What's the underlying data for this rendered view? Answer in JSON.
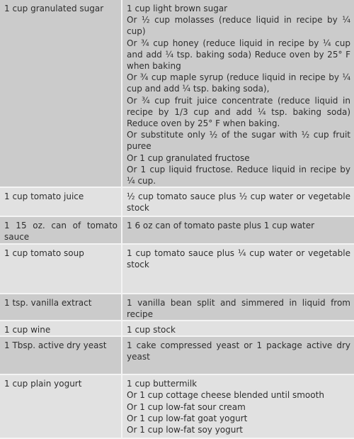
{
  "rows": [
    {
      "ingredient": "1 cup granulated sugar",
      "substitutes": [
        "1 cup light brown sugar",
        "Or ½ cup molasses (reduce liquid in recipe by ¼ cup)",
        "Or ¾ cup honey (reduce liquid in recipe by ¼ cup and add ¼ tsp. baking soda) Reduce oven by 25° F when baking",
        "Or ¾ cup maple syrup (reduce liquid in recipe by ¼ cup and add ¼ tsp. baking soda),",
        "Or ¾ cup fruit juice concentrate (reduce liquid in recipe by 1/3 cup and add ¼ tsp. baking soda) Reduce oven by 25° F when baking.",
        "Or substitute only ½ of the sugar with ½ cup fruit puree",
        "Or 1 cup granulated fructose",
        "Or 1 cup liquid fructose. Reduce liquid in recipe by ¼ cup."
      ]
    },
    {
      "ingredient": "1 cup tomato juice",
      "substitutes": [
        "½ cup tomato sauce plus ½ cup water or vegetable stock"
      ]
    },
    {
      "ingredient": "1 15 oz. can of tomato sauce",
      "substitutes": [
        "1 6 oz can of tomato paste plus 1 cup water"
      ]
    },
    {
      "ingredient": "1 cup tomato soup",
      "substitutes": [
        "1 cup tomato sauce plus ¼ cup water or vegetable stock"
      ]
    },
    {
      "ingredient": "1 tsp. vanilla extract",
      "substitutes": [
        "1 vanilla bean split and simmered in liquid from recipe"
      ]
    },
    {
      "ingredient": "1 cup wine",
      "substitutes": [
        "1 cup stock"
      ]
    },
    {
      "ingredient": "1 Tbsp. active dry yeast",
      "substitutes": [
        "1 cake compressed yeast or 1 package active dry yeast"
      ]
    },
    {
      "ingredient": "1 cup plain yogurt",
      "substitutes": [
        "1 cup buttermilk",
        "Or 1 cup cottage cheese blended until smooth",
        "Or 1 cup low-fat sour cream",
        "Or 1 cup low-fat goat yogurt",
        "Or 1 cup low-fat soy yogurt"
      ]
    }
  ],
  "colors": {
    "row_dark": "#cbcbcb",
    "row_light": "#e1e1e1",
    "text": "#2e2e2e",
    "divider": "#f4f4f4"
  }
}
